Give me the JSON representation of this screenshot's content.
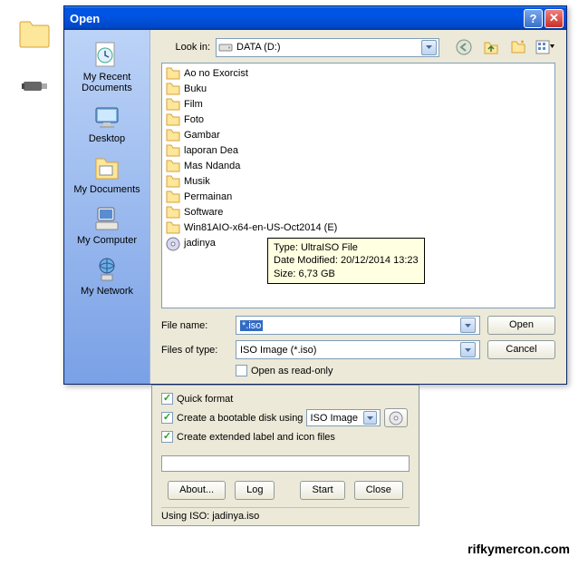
{
  "dialog": {
    "title": "Open",
    "lookin_label": "Look in:",
    "lookin_value": "DATA (D:)",
    "files": [
      "Ao no Exorcist",
      "Buku",
      "Film",
      "Foto",
      "Gambar",
      "laporan Dea",
      "Mas Ndanda",
      "Musik",
      "Permainan",
      "Software",
      "Win81AIO-x64-en-US-Oct2014 (E)"
    ],
    "iso_file": "jadinya",
    "tooltip": {
      "type_label": "Type: UltraISO File",
      "date_label": "Date Modified: 20/12/2014 13:23",
      "size_label": "Size: 6,73 GB"
    },
    "filename_label": "File name:",
    "filename_value": "*.iso",
    "filetype_label": "Files of type:",
    "filetype_value": "ISO Image (*.iso)",
    "readonly_label": "Open as read-only",
    "open_btn": "Open",
    "cancel_btn": "Cancel",
    "sidebar": {
      "recent": "My Recent Documents",
      "desktop": "Desktop",
      "mydocs": "My Documents",
      "mycomputer": "My Computer",
      "mynetwork": "My Network"
    }
  },
  "rufus": {
    "quick_format": "Quick format",
    "bootable": "Create a bootable disk using",
    "bootable_type": "ISO Image",
    "extended": "Create extended label and icon files",
    "about_btn": "About...",
    "log_btn": "Log",
    "start_btn": "Start",
    "close_btn": "Close",
    "status": "Using ISO: jadinya.iso"
  },
  "watermark": "rifkymercon.com"
}
